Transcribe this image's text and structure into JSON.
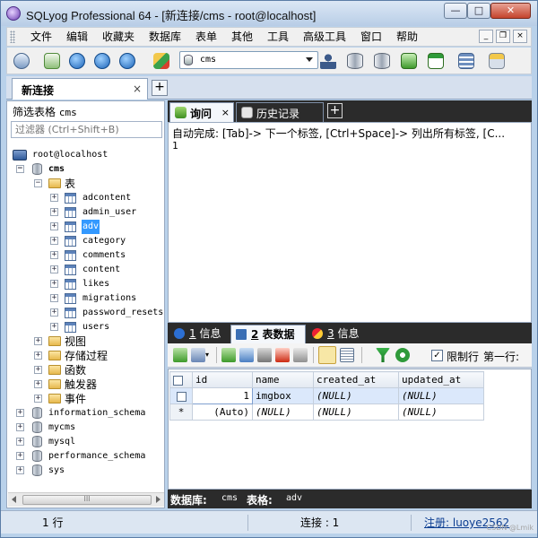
{
  "window": {
    "title": "SQLyog Professional 64 - [新连接/cms - root@localhost]",
    "controls": {
      "minimize": "—",
      "maximize": "□",
      "close": "✕"
    }
  },
  "menu": {
    "items": [
      "文件",
      "编辑",
      "收藏夹",
      "数据库",
      "表单",
      "其他",
      "工具",
      "高级工具",
      "窗口",
      "帮助"
    ]
  },
  "mdi_controls": {
    "minimize": "_",
    "restore": "❐",
    "close": "×"
  },
  "toolbar": {
    "database_selector": {
      "value": "cms"
    }
  },
  "connection_tabs": {
    "active": "新连接",
    "close_glyph": "×",
    "add_glyph": "+"
  },
  "object_browser": {
    "filter_label": "筛选表格",
    "filter_db": "cms",
    "filter_placeholder": "过滤器 (Ctrl+Shift+B)",
    "server": "root@localhost",
    "active_db": "cms",
    "tables_folder": "表",
    "tables": [
      "adcontent",
      "admin_user",
      "adv",
      "category",
      "comments",
      "content",
      "likes",
      "migrations",
      "password_resets",
      "users"
    ],
    "selected_table": "adv",
    "folders": [
      "视图",
      "存储过程",
      "函数",
      "触发器",
      "事件"
    ],
    "other_databases": [
      "information_schema",
      "mycms",
      "mysql",
      "performance_schema",
      "sys"
    ],
    "scroll_thumb": "III"
  },
  "query_tabs": {
    "tabs": [
      {
        "label": "询问",
        "active": true,
        "close": "×"
      },
      {
        "label": "历史记录",
        "active": false
      }
    ],
    "add_glyph": "+"
  },
  "editor": {
    "autocomplete_hint": "自动完成: [Tab]-> 下一个标签, [Ctrl+Space]-> 列出所有标签, [C...",
    "line_number": "1"
  },
  "result_tabs": {
    "tabs": [
      {
        "num": "1",
        "label": "信息",
        "active": false
      },
      {
        "num": "2",
        "label": "表数据",
        "active": true
      },
      {
        "num": "3",
        "label": "信息",
        "active": false
      }
    ]
  },
  "result_toolbar": {
    "limit_checked": true,
    "limit_label": "限制行",
    "first_row_label": "第一行:"
  },
  "grid": {
    "columns": [
      "id",
      "name",
      "created_at",
      "updated_at"
    ],
    "rows": [
      {
        "marker": "",
        "id": "1",
        "name": "imgbox",
        "created_at": "(NULL)",
        "updated_at": "(NULL)"
      },
      {
        "marker": "*",
        "id": "(Auto)",
        "name": "(NULL)",
        "created_at": "(NULL)",
        "updated_at": "(NULL)"
      }
    ]
  },
  "info_bar": {
    "db_label": "数据库:",
    "db_value": "cms",
    "table_label": "表格:",
    "table_value": "adv"
  },
  "status_bar": {
    "rows": "1 行",
    "connections": "连接 : 1",
    "registration": "注册: luoye2562",
    "watermark": "CSDN @Lmik"
  }
}
